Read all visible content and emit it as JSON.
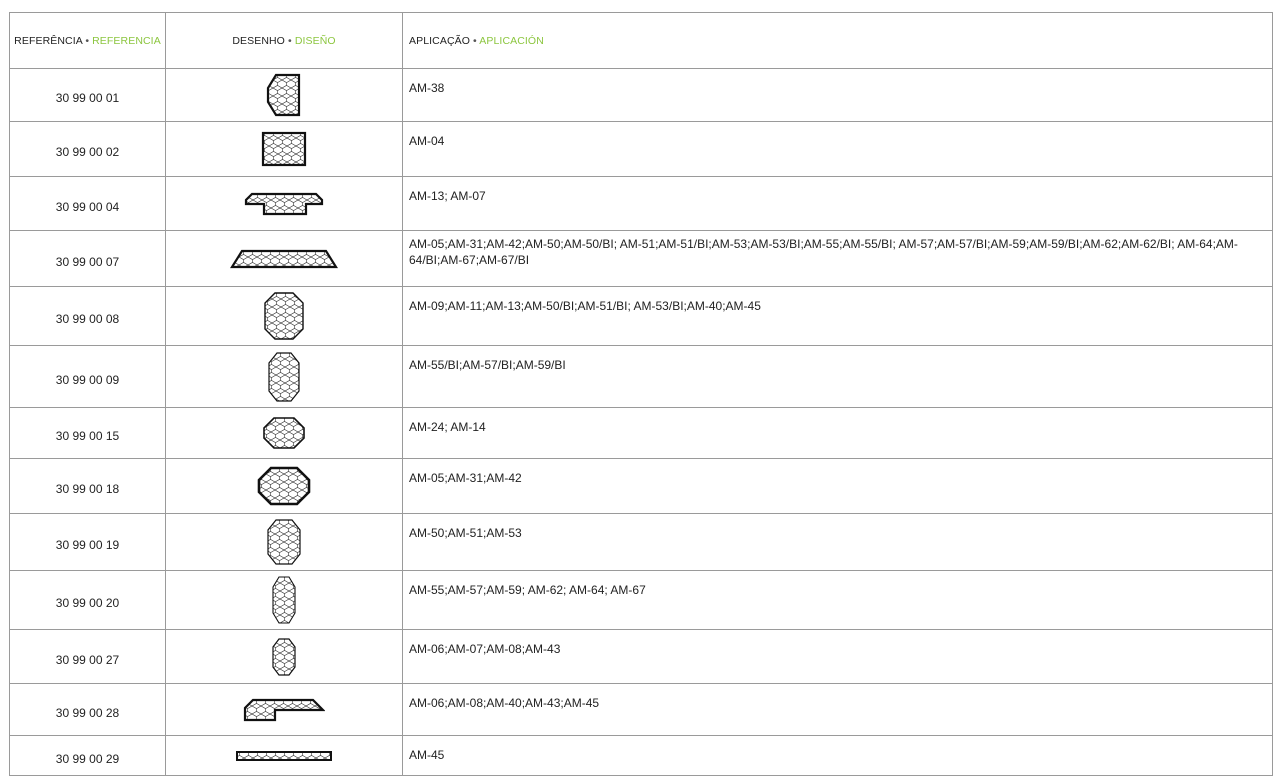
{
  "header": {
    "ref": "REFERÊNCIA",
    "ref_es": "REFERENCIA",
    "draw": "DESENHO",
    "draw_es": "DISEÑO",
    "app": "APLICAÇÃO",
    "app_es": "APLICACIÓN",
    "separator": "•"
  },
  "colors": {
    "accent": "#8cc63f",
    "border": "#9a9a9a",
    "text": "#222222"
  },
  "rows": [
    {
      "ref": "30 99 00 01",
      "shape": "tall-chamfer-left-hex-grid-icon",
      "app": "AM-38"
    },
    {
      "ref": "30 99 00 02",
      "shape": "square-hex-grid-icon",
      "app": "AM-04"
    },
    {
      "ref": "30 99 00 04",
      "shape": "flanged-bar-hex-grid-icon",
      "app": "AM-13; AM-07"
    },
    {
      "ref": "30 99 00 07",
      "shape": "long-trapezoid-hex-grid-icon",
      "app": "AM-05;AM-31;AM-42;AM-50;AM-50/BI; AM-51;AM-51/BI;AM-53;AM-53/BI;AM-55;AM-55/BI; AM-57;AM-57/BI;AM-59;AM-59/BI;AM-62;AM-62/BI; AM-64;AM-64/BI;AM-67;AM-67/BI"
    },
    {
      "ref": "30 99 00 08",
      "shape": "octagon-hex-grid-icon",
      "app": "AM-09;AM-11;AM-13;AM-50/BI;AM-51/BI; AM-53/BI;AM-40;AM-45"
    },
    {
      "ref": "30 99 00 09",
      "shape": "tall-octagon-hex-grid-icon",
      "app": "AM-55/BI;AM-57/BI;AM-59/BI"
    },
    {
      "ref": "30 99 00 15",
      "shape": "small-octagon-hex-grid-icon",
      "app": "AM-24; AM-14"
    },
    {
      "ref": "30 99 00 18",
      "shape": "wide-octagon-hex-grid-icon",
      "app": "AM-05;AM-31;AM-42"
    },
    {
      "ref": "30 99 00 19",
      "shape": "tall-octagon-hex-grid-icon",
      "app": "AM-50;AM-51;AM-53"
    },
    {
      "ref": "30 99 00 20",
      "shape": "narrow-tall-octagon-hex-grid-icon",
      "app": "AM-55;AM-57;AM-59; AM-62; AM-64; AM-67"
    },
    {
      "ref": "30 99 00 27",
      "shape": "small-tall-octagon-hex-grid-icon",
      "app": "AM-06;AM-07;AM-08;AM-43"
    },
    {
      "ref": "30 99 00 28",
      "shape": "stepped-bar-hex-grid-icon",
      "app": "AM-06;AM-08;AM-40;AM-43;AM-45"
    },
    {
      "ref": "30 99 00 29",
      "shape": "thin-bar-hex-grid-icon",
      "app": "AM-45"
    }
  ]
}
